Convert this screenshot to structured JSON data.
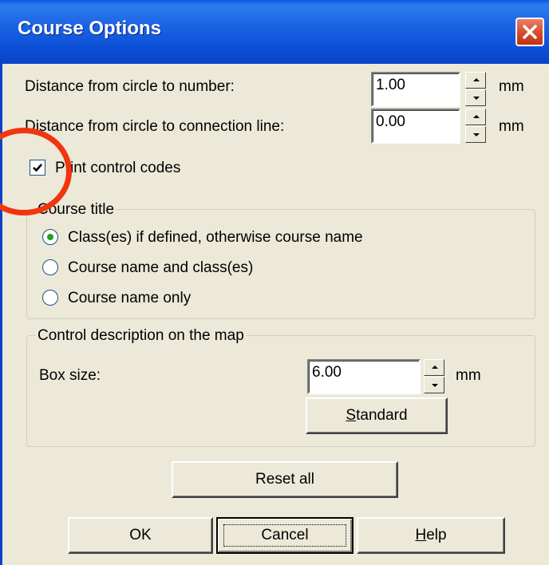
{
  "window": {
    "title": "Course Options"
  },
  "fields": {
    "circle_to_number": {
      "label": "Distance from circle to number:",
      "value": "1.00",
      "unit": "mm"
    },
    "circle_to_line": {
      "label": "Distance from circle to connection line:",
      "value": "0.00",
      "unit": "mm"
    }
  },
  "print_codes": {
    "label": "Print control codes",
    "checked": true
  },
  "course_title": {
    "legend": "Course title",
    "options": [
      {
        "label": "Class(es) if defined, otherwise course name",
        "selected": true
      },
      {
        "label": "Course name and class(es)",
        "selected": false
      },
      {
        "label": "Course name only",
        "selected": false
      }
    ]
  },
  "control_desc": {
    "legend": "Control description on the map",
    "box_size_label": "Box size:",
    "box_size_value": "6.00",
    "unit": "mm",
    "standard_prefix": "",
    "standard_mnemonic": "S",
    "standard_rest": "tandard"
  },
  "buttons": {
    "reset_all": "Reset all",
    "ok": "OK",
    "cancel": "Cancel",
    "help_mnemonic": "H",
    "help_rest": "elp"
  },
  "colors": {
    "titlebar": "#0A4FD8",
    "annotation": "#F0350F",
    "face": "#ECE9D8"
  }
}
